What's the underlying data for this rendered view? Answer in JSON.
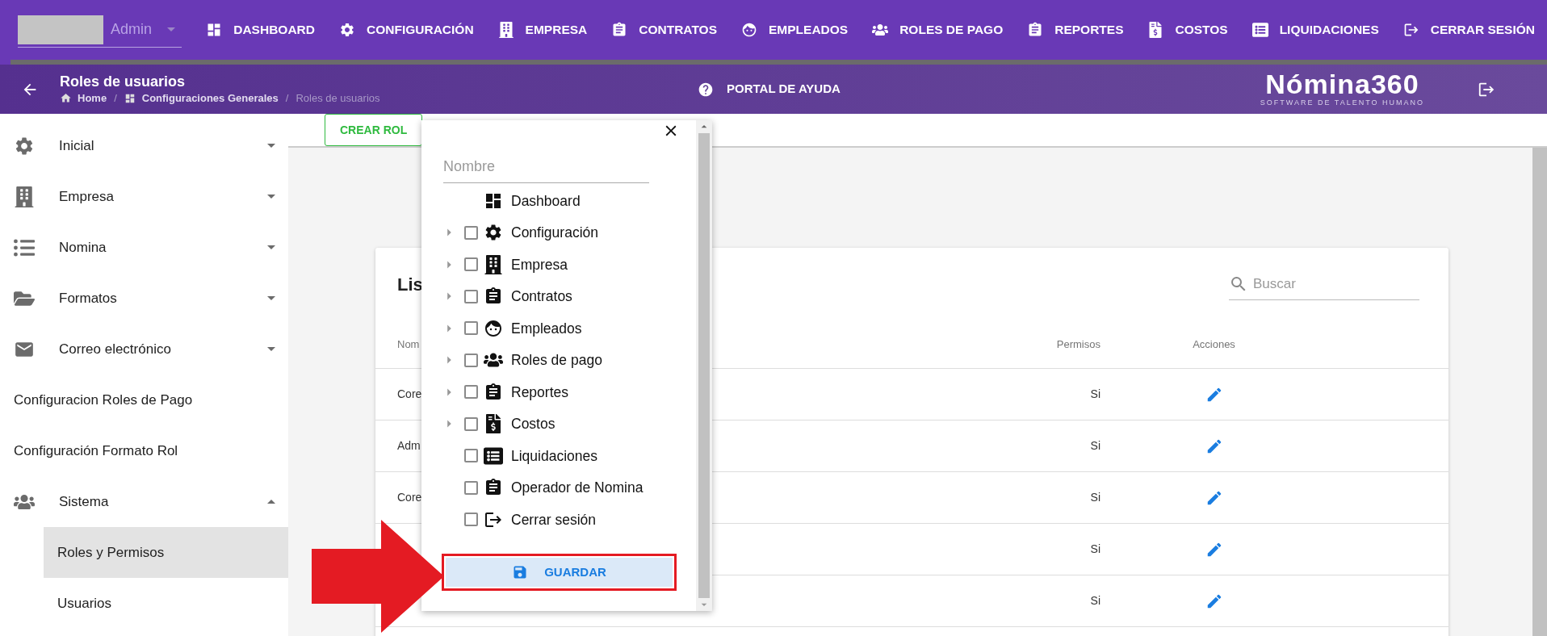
{
  "account": {
    "value": "Admin"
  },
  "nav": [
    {
      "label": "DASHBOARD"
    },
    {
      "label": "CONFIGURACIÓN"
    },
    {
      "label": "EMPRESA"
    },
    {
      "label": "CONTRATOS"
    },
    {
      "label": "EMPLEADOS"
    },
    {
      "label": "ROLES DE PAGO"
    },
    {
      "label": "REPORTES"
    },
    {
      "label": "COSTOS"
    },
    {
      "label": "LIQUIDACIONES"
    },
    {
      "label": "CERRAR SESIÓN"
    }
  ],
  "header": {
    "title": "Roles de usuarios",
    "breadcrumb": [
      "Home",
      "Configuraciones Generales",
      "Roles de usuarios"
    ],
    "separator": "/",
    "help": "PORTAL DE AYUDA",
    "logo": "Nómina360",
    "logo_tagline": "SOFTWARE DE TALENTO HUMANO"
  },
  "sidebar": {
    "items": [
      {
        "label": "Inicial",
        "kind": "group",
        "expanded": false
      },
      {
        "label": "Empresa",
        "kind": "group",
        "expanded": false
      },
      {
        "label": "Nomina",
        "kind": "group",
        "expanded": false
      },
      {
        "label": "Formatos",
        "kind": "group",
        "expanded": false
      },
      {
        "label": "Correo electrónico",
        "kind": "group",
        "expanded": false
      },
      {
        "label": "Configuracion Roles de Pago",
        "kind": "link"
      },
      {
        "label": "Configuración Formato Rol",
        "kind": "link"
      },
      {
        "label": "Sistema",
        "kind": "group",
        "expanded": true,
        "children": [
          {
            "label": "Roles y Permisos",
            "selected": true
          },
          {
            "label": "Usuarios",
            "selected": false
          }
        ]
      }
    ]
  },
  "create_button": "CREAR ROL",
  "card": {
    "title": "Lis",
    "search": {
      "placeholder": "Buscar"
    },
    "columns": [
      "Nom",
      "Permisos",
      "Acciones"
    ],
    "rows": [
      {
        "name": "Core",
        "permisos": "Si"
      },
      {
        "name": "Adm",
        "permisos": "Si"
      },
      {
        "name": "Core",
        "permisos": "Si"
      },
      {
        "permisos": "Si"
      },
      {
        "permisos": "Si"
      }
    ]
  },
  "dialog": {
    "name_field": {
      "placeholder": "Nombre"
    },
    "tree": [
      {
        "label": "Dashboard",
        "kind": "plain"
      },
      {
        "label": "Configuración",
        "kind": "checkbox",
        "has_children": true,
        "checked": false
      },
      {
        "label": "Empresa",
        "kind": "checkbox",
        "has_children": true,
        "checked": false
      },
      {
        "label": "Contratos",
        "kind": "checkbox",
        "has_children": true,
        "checked": false
      },
      {
        "label": "Empleados",
        "kind": "checkbox",
        "has_children": true,
        "checked": false
      },
      {
        "label": "Roles de pago",
        "kind": "checkbox",
        "has_children": true,
        "checked": false
      },
      {
        "label": "Reportes",
        "kind": "checkbox",
        "has_children": true,
        "checked": false
      },
      {
        "label": "Costos",
        "kind": "checkbox",
        "has_children": true,
        "checked": false
      },
      {
        "label": "Liquidaciones",
        "kind": "checkbox",
        "has_children": false,
        "checked": false
      },
      {
        "label": "Operador de Nomina",
        "kind": "checkbox",
        "has_children": false,
        "checked": false
      },
      {
        "label": "Cerrar sesión",
        "kind": "checkbox",
        "has_children": false,
        "checked": false
      }
    ],
    "save_button": "GUARDAR"
  }
}
